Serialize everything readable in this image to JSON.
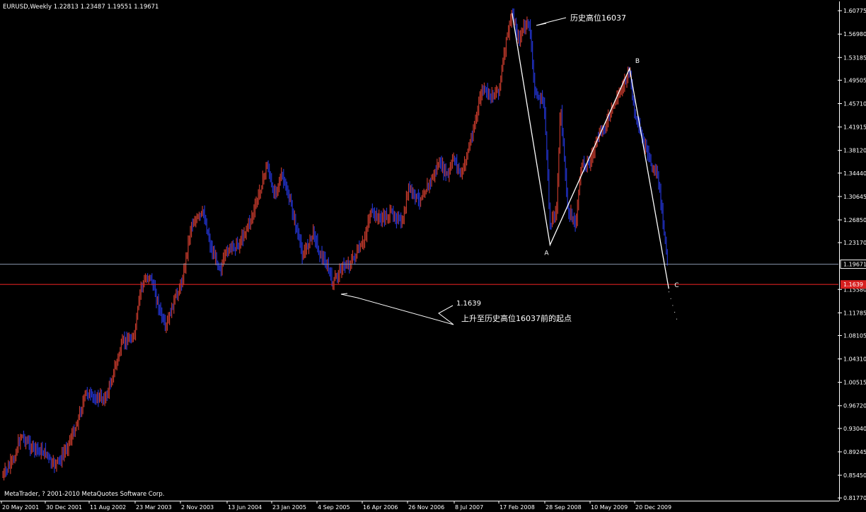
{
  "chart_data": {
    "type": "bar",
    "symbol_header": "EURUSD,Weekly  1.22813 1.23487 1.19551 1.19671",
    "copyright": "MetaTrader, ? 2001-2010 MetaQuotes Software Corp.",
    "ylim": [
      0.8144,
      1.6228
    ],
    "y_ticks": [
      "1.60775",
      "1.56980",
      "1.53185",
      "1.49505",
      "1.45710",
      "1.41915",
      "1.38120",
      "1.34440",
      "1.30645",
      "1.26850",
      "1.23170",
      "1.15580",
      "1.11785",
      "1.08105",
      "1.04310",
      "1.00515",
      "0.96720",
      "0.93040",
      "0.89245",
      "0.85450",
      "0.81770"
    ],
    "x_ticks": [
      "20 May 2001",
      "30 Dec 2001",
      "11 Aug 2002",
      "23 Mar 2003",
      "2 Nov 2003",
      "13 Jun 2004",
      "23 Jan 2005",
      "4 Sep 2005",
      "16 Apr 2006",
      "26 Nov 2006",
      "8 Jul 2007",
      "17 Feb 2008",
      "28 Sep 2008",
      "10 May 2009",
      "20 Dec 2009"
    ],
    "current_price_label": "1.19671",
    "current_price": 1.19671,
    "red_line_price": 1.1639,
    "red_line_label": "1.1639",
    "up_color": "#c0392b",
    "down_color": "#2233cc",
    "bg_color": "#000000",
    "price_points": [
      [
        "2001-05-20",
        0.85
      ],
      [
        "2001-07-20",
        0.88
      ],
      [
        "2001-08-25",
        0.92
      ],
      [
        "2001-10-15",
        0.9
      ],
      [
        "2001-12-30",
        0.89
      ],
      [
        "2002-01-25",
        0.87
      ],
      [
        "2002-03-10",
        0.88
      ],
      [
        "2002-05-20",
        0.93
      ],
      [
        "2002-07-15",
        0.99
      ],
      [
        "2002-08-11",
        0.98
      ],
      [
        "2002-10-20",
        0.98
      ],
      [
        "2003-01-10",
        1.07
      ],
      [
        "2003-03-10",
        1.08
      ],
      [
        "2003-04-10",
        1.16
      ],
      [
        "2003-05-25",
        1.18
      ],
      [
        "2003-06-20",
        1.15
      ],
      [
        "2003-08-10",
        1.09
      ],
      [
        "2003-09-15",
        1.13
      ],
      [
        "2003-11-02",
        1.17
      ],
      [
        "2003-12-15",
        1.26
      ],
      [
        "2004-02-15",
        1.28
      ],
      [
        "2004-03-25",
        1.22
      ],
      [
        "2004-05-10",
        1.19
      ],
      [
        "2004-06-13",
        1.22
      ],
      [
        "2004-08-10",
        1.23
      ],
      [
        "2004-10-20",
        1.28
      ],
      [
        "2004-12-28",
        1.36
      ],
      [
        "2005-01-23",
        1.31
      ],
      [
        "2005-03-10",
        1.34
      ],
      [
        "2005-04-25",
        1.29
      ],
      [
        "2005-06-20",
        1.21
      ],
      [
        "2005-08-15",
        1.25
      ],
      [
        "2005-09-04",
        1.22
      ],
      [
        "2005-10-25",
        1.19
      ],
      [
        "2005-11-15",
        1.1639
      ],
      [
        "2005-12-25",
        1.19
      ],
      [
        "2006-02-15",
        1.2
      ],
      [
        "2006-04-16",
        1.23
      ],
      [
        "2006-05-20",
        1.28
      ],
      [
        "2006-07-15",
        1.27
      ],
      [
        "2006-09-10",
        1.28
      ],
      [
        "2006-10-25",
        1.26
      ],
      [
        "2006-11-26",
        1.32
      ],
      [
        "2007-01-15",
        1.3
      ],
      [
        "2007-03-15",
        1.33
      ],
      [
        "2007-04-25",
        1.36
      ],
      [
        "2007-06-10",
        1.34
      ],
      [
        "2007-07-08",
        1.37
      ],
      [
        "2007-08-15",
        1.34
      ],
      [
        "2007-10-10",
        1.41
      ],
      [
        "2007-11-25",
        1.48
      ],
      [
        "2008-01-10",
        1.47
      ],
      [
        "2008-02-17",
        1.48
      ],
      [
        "2008-03-25",
        1.56
      ],
      [
        "2008-04-22",
        1.6037
      ],
      [
        "2008-05-25",
        1.56
      ],
      [
        "2008-06-20",
        1.58
      ],
      [
        "2008-07-15",
        1.59
      ],
      [
        "2008-08-15",
        1.47
      ],
      [
        "2008-09-28",
        1.46
      ],
      [
        "2008-10-27",
        1.26
      ],
      [
        "2008-11-30",
        1.29
      ],
      [
        "2008-12-18",
        1.46
      ],
      [
        "2009-01-20",
        1.29
      ],
      [
        "2009-03-04",
        1.26
      ],
      [
        "2009-03-30",
        1.36
      ],
      [
        "2009-05-10",
        1.36
      ],
      [
        "2009-06-20",
        1.4
      ],
      [
        "2009-08-10",
        1.43
      ],
      [
        "2009-10-10",
        1.48
      ],
      [
        "2009-11-25",
        1.51
      ],
      [
        "2009-12-20",
        1.44
      ],
      [
        "2010-01-25",
        1.4
      ],
      [
        "2010-03-10",
        1.36
      ],
      [
        "2010-04-15",
        1.34
      ],
      [
        "2010-05-15",
        1.25
      ],
      [
        "2010-06-05",
        1.19
      ]
    ],
    "abc_pattern": [
      [
        "2008-04-22",
        1.6037,
        ""
      ],
      [
        "2008-10-27",
        1.228,
        "A"
      ],
      [
        "2009-11-25",
        1.514,
        "B"
      ],
      [
        "2010-06-07",
        1.157,
        "C"
      ]
    ],
    "annotations": {
      "top_high": "历史高位16037",
      "low_price": "1.1639",
      "low_note": "上升至历史高位16037前的起点"
    }
  }
}
